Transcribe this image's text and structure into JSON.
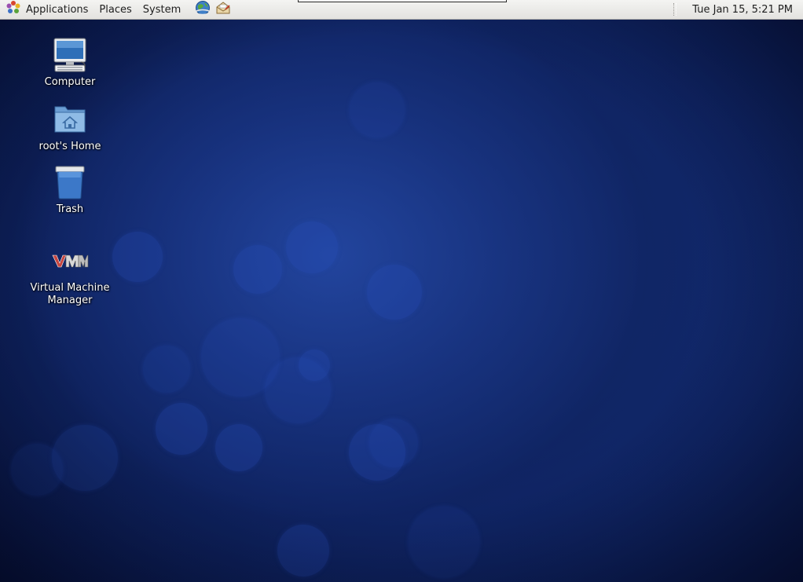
{
  "panel": {
    "menus": {
      "applications": "Applications",
      "places": "Places",
      "system": "System"
    },
    "launchers": [
      {
        "name": "web-browser-icon"
      },
      {
        "name": "email-client-icon"
      }
    ],
    "clock": "Tue Jan 15,  5:21 PM"
  },
  "desktop": {
    "icons": [
      {
        "name": "computer",
        "label": "Computer",
        "icon": "computer-icon"
      },
      {
        "name": "home",
        "label": "root's Home",
        "icon": "home-folder-icon"
      },
      {
        "name": "trash",
        "label": "Trash",
        "icon": "trash-icon"
      },
      {
        "name": "virt-manager",
        "label": "Virtual Machine Manager",
        "icon": "virtual-machine-manager-icon"
      }
    ]
  },
  "colors": {
    "panel_bg": "#e9e8e5",
    "desktop_bg": "#10276a",
    "label_text": "#ffffff"
  }
}
